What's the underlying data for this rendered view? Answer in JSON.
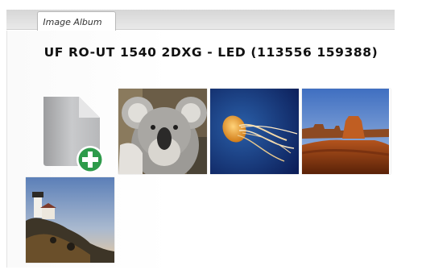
{
  "tabs": [
    {
      "label": "Image Album",
      "active": true
    }
  ],
  "album": {
    "title": "UF RO-UT 1540 2DXG - LED (113556 159388)",
    "add_icon": "add-file-icon",
    "photos": [
      {
        "subject": "koala"
      },
      {
        "subject": "jellyfish"
      },
      {
        "subject": "desert-mesa"
      },
      {
        "subject": "lighthouse"
      }
    ]
  },
  "colors": {
    "add_green": "#2e9b4b",
    "file_gray": "#a9aaac"
  }
}
